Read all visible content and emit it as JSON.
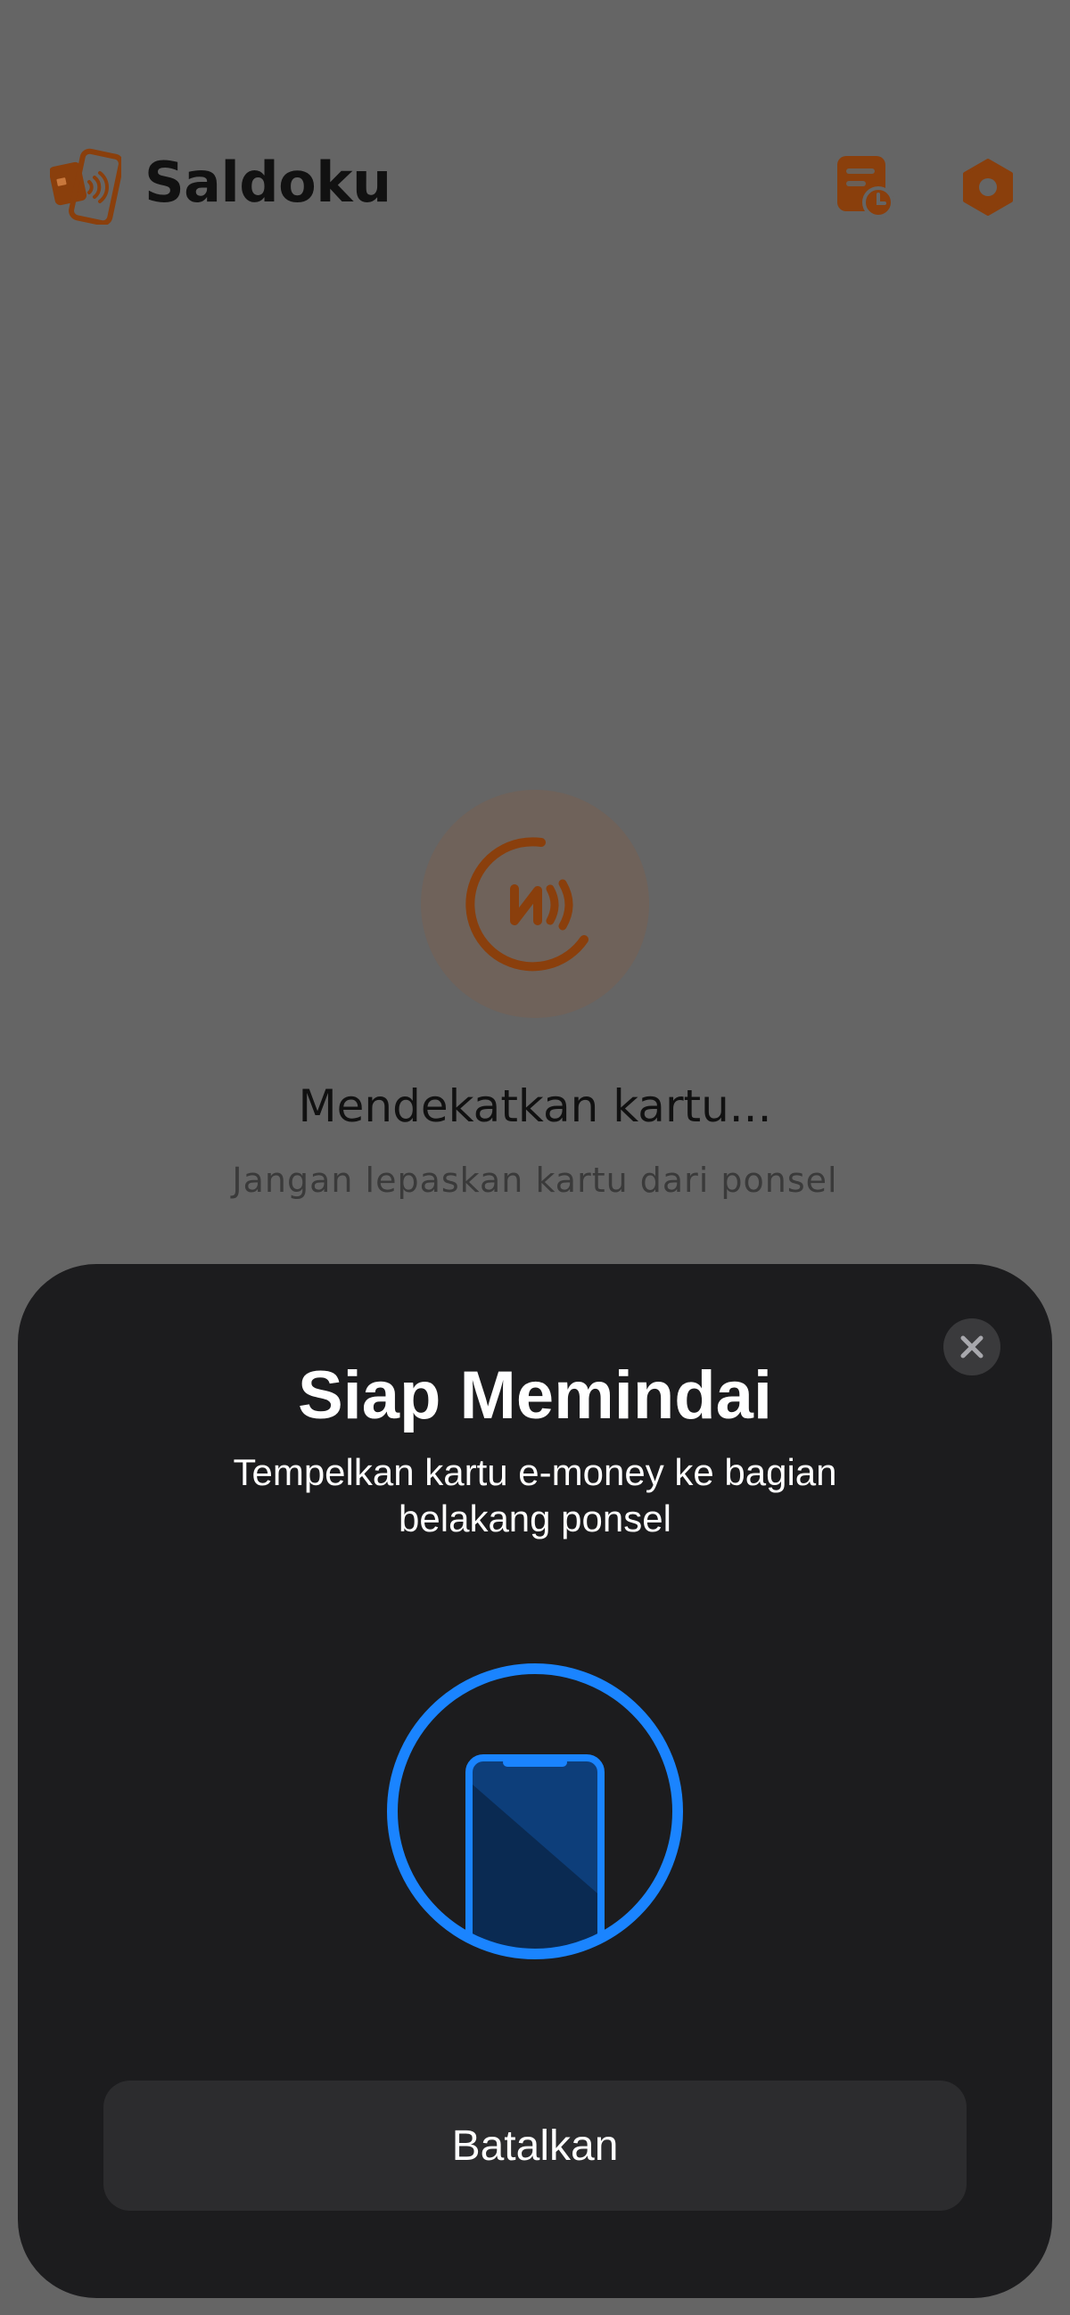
{
  "app": {
    "title": "Saldoku",
    "logo_icon": "phone-card-nfc-logo",
    "brand_color": "#a34b0d"
  },
  "header": {
    "history_icon": "history-list-clock-icon",
    "settings_icon": "settings-hexagon-icon"
  },
  "nfc_status": {
    "icon": "nfc-icon",
    "title": "Mendekatkan kartu...",
    "subtitle": "Jangan lepaskan kartu dari ponsel"
  },
  "scan_sheet": {
    "title": "Siap Memindai",
    "message": "Tempelkan kartu e-money ke bagian belakang ponsel",
    "close_icon": "close-icon",
    "illustration_icon": "phone-scan-icon",
    "accent_color": "#1a84ff",
    "cancel_label": "Batalkan"
  }
}
